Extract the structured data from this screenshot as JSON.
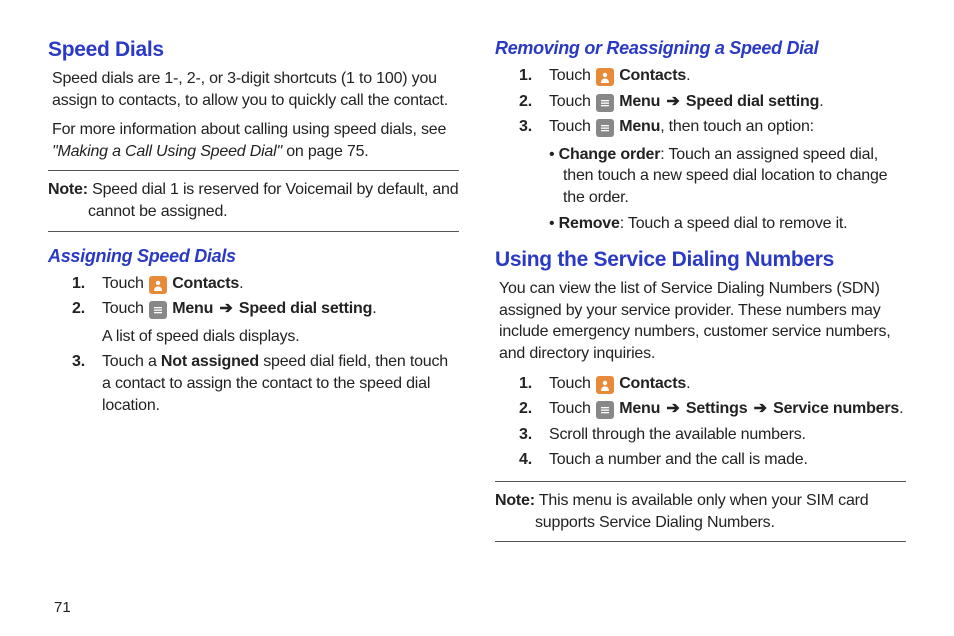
{
  "left": {
    "h1": "Speed Dials",
    "p1": "Speed dials are 1-, 2-, or 3-digit shortcuts (1 to 100) you assign to contacts, to allow you to quickly call the contact.",
    "p2a": "For more information about calling using speed dials, see ",
    "p2b": "\"Making a Call Using Speed Dial\"",
    "p2c": " on page 75.",
    "note_label": "Note:",
    "note_text1": " Speed dial 1 is reserved for Voicemail by default, and ",
    "note_text2": "cannot be assigned.",
    "h2": "Assigning Speed Dials",
    "s1_num": "1.",
    "s1_touch": "Touch ",
    "s1_contacts": " Contacts",
    "s1_dot": ".",
    "s2_num": "2.",
    "s2_touch": "Touch ",
    "s2_menu": " Menu ",
    "s2_arrow": "➔",
    "s2_dest": " Speed dial setting",
    "s2_dot": ".",
    "s2_sub": "A list of speed dials displays.",
    "s3_num": "3.",
    "s3_a": "Touch a ",
    "s3_b": "Not assigned",
    "s3_c": " speed dial field, then touch a contact to assign the contact to the speed dial location."
  },
  "right": {
    "h2a": "Removing or Reassigning a Speed Dial",
    "a1_num": "1.",
    "a1_touch": "Touch ",
    "a1_contacts": " Contacts",
    "a1_dot": ".",
    "a2_num": "2.",
    "a2_touch": "Touch ",
    "a2_menu": " Menu ",
    "a2_arrow": "➔",
    "a2_dest": " Speed dial setting",
    "a2_dot": ".",
    "a3_num": "3.",
    "a3_touch": "Touch ",
    "a3_menu": " Menu",
    "a3_rest": ", then touch an option:",
    "b1_lab": "Change order",
    "b1_txt": ": Touch an assigned speed dial, then touch a new speed dial location to change the order.",
    "b2_lab": "Remove",
    "b2_txt": ": Touch a speed dial to remove it.",
    "h1b": "Using the Service Dialing Numbers",
    "p3": "You can view the list of Service Dialing Numbers (SDN) assigned by your service provider. These numbers may include emergency numbers, customer service numbers, and directory inquiries.",
    "c1_num": "1.",
    "c1_touch": "Touch ",
    "c1_contacts": " Contacts",
    "c1_dot": ".",
    "c2_num": "2.",
    "c2_touch": "Touch ",
    "c2_menu": " Menu ",
    "c2_ar1": "➔",
    "c2_set": " Settings ",
    "c2_ar2": "➔",
    "c2_sn": " Service numbers",
    "c2_dot": ".",
    "c3_num": "3.",
    "c3_txt": "Scroll through the available numbers.",
    "c4_num": "4.",
    "c4_txt": "Touch a number and the call is made.",
    "note2_label": "Note:",
    "note2_txt1": " This menu is available only when your SIM card ",
    "note2_txt2": "supports Service Dialing Numbers."
  },
  "page": "71"
}
